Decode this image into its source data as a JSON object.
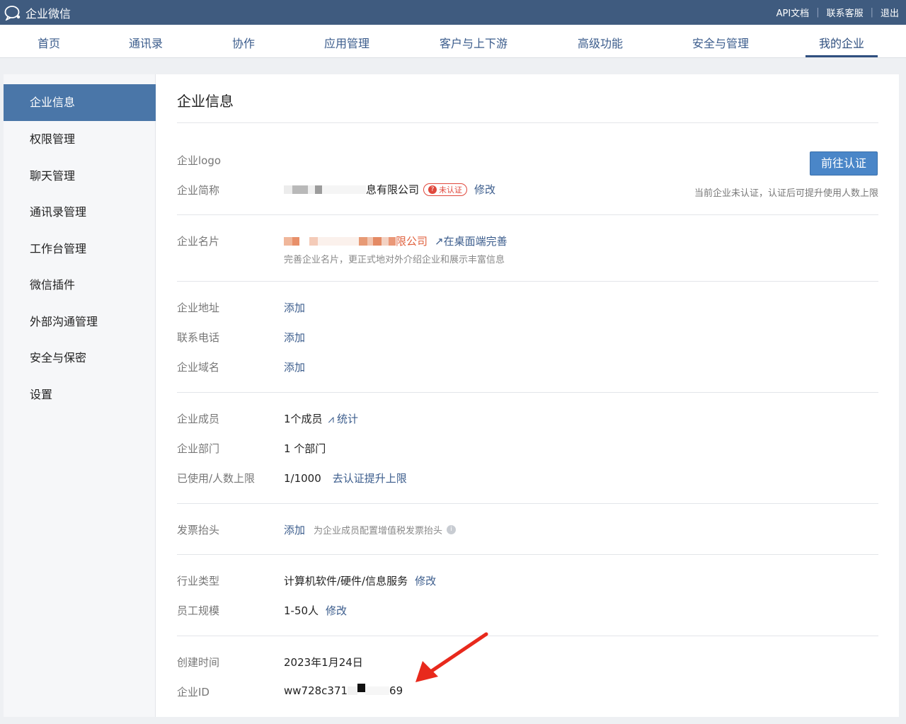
{
  "topbar": {
    "brand": "企业微信",
    "links": [
      "API文档",
      "联系客服",
      "退出"
    ]
  },
  "nav": {
    "tabs": [
      "首页",
      "通讯录",
      "协作",
      "应用管理",
      "客户与上下游",
      "高级功能",
      "安全与管理",
      "我的企业"
    ],
    "active": "我的企业"
  },
  "sidebar": {
    "items": [
      "企业信息",
      "权限管理",
      "聊天管理",
      "通讯录管理",
      "工作台管理",
      "微信插件",
      "外部沟通管理",
      "安全与保密",
      "设置"
    ],
    "active": "企业信息"
  },
  "main": {
    "title": "企业信息",
    "certify_button": "前往认证",
    "certify_note": "当前企业未认证，认证后可提升使用人数上限",
    "logo_label": "企业logo",
    "short_name": {
      "label": "企业简称",
      "value_suffix": "息有限公司",
      "badge": "未认证",
      "edit": "修改"
    },
    "card": {
      "label": "企业名片",
      "value_suffix": "限公司",
      "link": "在桌面端完善",
      "desc": "完善企业名片，更正式地对外介绍企业和展示丰富信息"
    },
    "address": {
      "label": "企业地址",
      "action": "添加"
    },
    "phone": {
      "label": "联系电话",
      "action": "添加"
    },
    "domain": {
      "label": "企业域名",
      "action": "添加"
    },
    "members": {
      "label": "企业成员",
      "value": "1个成员",
      "link": "统计"
    },
    "departments": {
      "label": "企业部门",
      "value": "1 个部门"
    },
    "usage": {
      "label": "已使用/人数上限",
      "value": "1/1000",
      "link": "去认证提升上限"
    },
    "invoice": {
      "label": "发票抬头",
      "action": "添加",
      "hint": "为企业成员配置增值税发票抬头"
    },
    "industry": {
      "label": "行业类型",
      "value": "计算机软件/硬件/信息服务",
      "edit": "修改"
    },
    "size": {
      "label": "员工规模",
      "value": "1-50人",
      "edit": "修改"
    },
    "created": {
      "label": "创建时间",
      "value": "2023年1月24日"
    },
    "corp_id": {
      "label": "企业ID",
      "value_prefix": "ww728c371",
      "value_suffix": "69"
    }
  }
}
